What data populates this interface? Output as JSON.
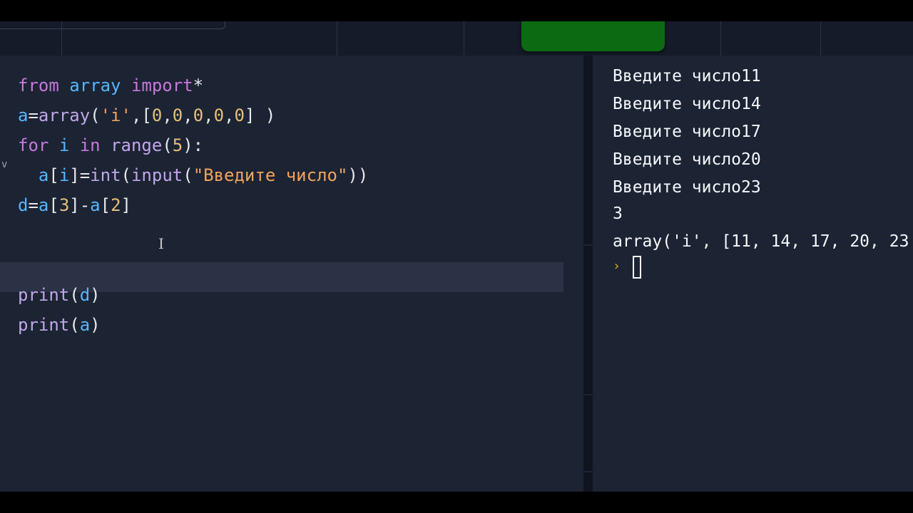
{
  "editor": {
    "lines": [
      [
        {
          "t": "from",
          "c": "kw"
        },
        {
          "t": " ",
          "c": "plain"
        },
        {
          "t": "array",
          "c": "var"
        },
        {
          "t": " ",
          "c": "plain"
        },
        {
          "t": "import",
          "c": "kw"
        },
        {
          "t": "*",
          "c": "plain"
        }
      ],
      [
        {
          "t": "a",
          "c": "var"
        },
        {
          "t": "=",
          "c": "plain"
        },
        {
          "t": "array",
          "c": "fn"
        },
        {
          "t": "(",
          "c": "plain"
        },
        {
          "t": "'i'",
          "c": "str"
        },
        {
          "t": ",[",
          "c": "plain"
        },
        {
          "t": "0",
          "c": "num"
        },
        {
          "t": ",",
          "c": "plain"
        },
        {
          "t": "0",
          "c": "num"
        },
        {
          "t": ",",
          "c": "plain"
        },
        {
          "t": "0",
          "c": "num"
        },
        {
          "t": ",",
          "c": "plain"
        },
        {
          "t": "0",
          "c": "num"
        },
        {
          "t": ",",
          "c": "plain"
        },
        {
          "t": "0",
          "c": "num"
        },
        {
          "t": "] )",
          "c": "plain"
        }
      ],
      [
        {
          "t": "for",
          "c": "kw"
        },
        {
          "t": " ",
          "c": "plain"
        },
        {
          "t": "i",
          "c": "var"
        },
        {
          "t": " ",
          "c": "plain"
        },
        {
          "t": "in",
          "c": "kw"
        },
        {
          "t": " ",
          "c": "plain"
        },
        {
          "t": "range",
          "c": "bi"
        },
        {
          "t": "(",
          "c": "plain"
        },
        {
          "t": "5",
          "c": "num"
        },
        {
          "t": "):",
          "c": "plain"
        }
      ],
      [
        {
          "t": "  ",
          "c": "plain"
        },
        {
          "t": "a",
          "c": "var"
        },
        {
          "t": "[",
          "c": "plain"
        },
        {
          "t": "i",
          "c": "var"
        },
        {
          "t": "]=",
          "c": "plain"
        },
        {
          "t": "int",
          "c": "bi"
        },
        {
          "t": "(",
          "c": "plain"
        },
        {
          "t": "input",
          "c": "bi"
        },
        {
          "t": "(",
          "c": "plain"
        },
        {
          "t": "\"Введите число\"",
          "c": "str"
        },
        {
          "t": "))",
          "c": "plain"
        }
      ],
      [
        {
          "t": "d",
          "c": "var"
        },
        {
          "t": "=",
          "c": "plain"
        },
        {
          "t": "a",
          "c": "var"
        },
        {
          "t": "[",
          "c": "plain"
        },
        {
          "t": "3",
          "c": "num"
        },
        {
          "t": "]-",
          "c": "plain"
        },
        {
          "t": "a",
          "c": "var"
        },
        {
          "t": "[",
          "c": "plain"
        },
        {
          "t": "2",
          "c": "num"
        },
        {
          "t": "]",
          "c": "plain"
        }
      ],
      [],
      [],
      [
        {
          "t": "print",
          "c": "bi"
        },
        {
          "t": "(",
          "c": "plain"
        },
        {
          "t": "d",
          "c": "var"
        },
        {
          "t": ")",
          "c": "plain"
        }
      ],
      [
        {
          "t": "print",
          "c": "bi"
        },
        {
          "t": "(",
          "c": "plain"
        },
        {
          "t": "a",
          "c": "var"
        },
        {
          "t": ")",
          "c": "plain"
        }
      ]
    ],
    "fold_glyph": "v",
    "ibeam_glyph": "I"
  },
  "console": {
    "lines": [
      "Введите число11",
      "Введите число14",
      "Введите число17",
      "Введите число20",
      "Введите число23",
      "3",
      "array('i', [11, 14, 17, 20, 23"
    ],
    "prompt_glyph": "›"
  },
  "colors": {
    "background": "#1c2333",
    "keyword": "#c678dd",
    "variable": "#56b6ff",
    "number": "#e5c07b",
    "string": "#f0a35e",
    "run_button": "#0c6b12",
    "prompt": "#e0b12f"
  }
}
